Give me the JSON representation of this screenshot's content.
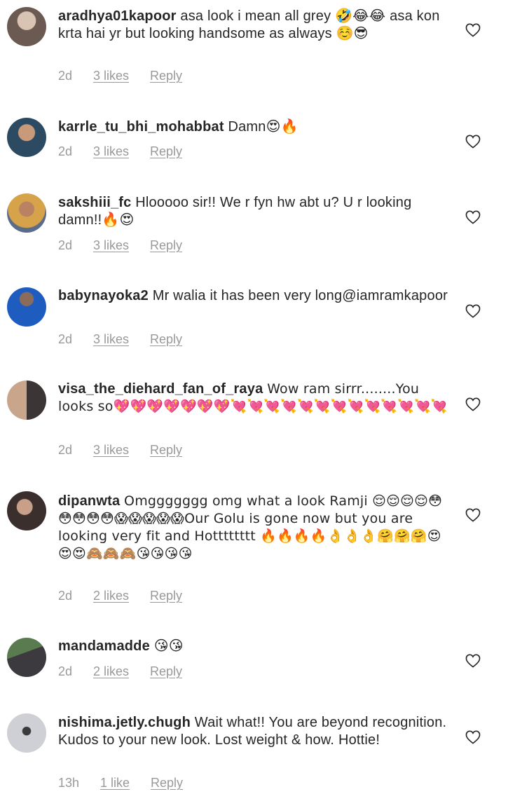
{
  "comments": [
    {
      "username": "aradhya01kapoor",
      "text": "asa look i mean all grey 🤣😂😂 asa kon krta hai yr but looking handsome as always ☺️😎",
      "time": "2d",
      "likes": "3 likes",
      "reply": "Reply"
    },
    {
      "username": "karrle_tu_bhi_mohabbat",
      "text": "Damn😍🔥",
      "time": "2d",
      "likes": "3 likes",
      "reply": "Reply"
    },
    {
      "username": "sakshiii_fc",
      "text": "Hlooooo sir!! We r fyn hw abt u? U r looking damn!!🔥😍",
      "time": "2d",
      "likes": "3 likes",
      "reply": "Reply"
    },
    {
      "username": "babynayoka2",
      "text": "Mr walia it has been very long@iamramkapoor",
      "time": "2d",
      "likes": "3 likes",
      "reply": "Reply"
    },
    {
      "username": "visa_the_diehard_fan_of_raya",
      "text": "Wow ram sirrr........You looks so💖💖💖💖💖💖💖💘💘💘💘💘💘💘💘💘💘💘💘💘",
      "time": "2d",
      "likes": "3 likes",
      "reply": "Reply"
    },
    {
      "username": "dipanwta",
      "text": "Omggggggg omg what a look Ramji 😌😌😌😌😳😳😳😳😳😱😱😱😱😱Our Golu is gone now but you are looking very fit and Hotttttttt 🔥🔥🔥🔥👌👌👌🤗🤗🤗😍😍😍🙈🙈🙈😘😘😘😘",
      "time": "2d",
      "likes": "2 likes",
      "reply": "Reply"
    },
    {
      "username": "mandamadde",
      "text": "😘😘",
      "time": "2d",
      "likes": "2 likes",
      "reply": "Reply"
    },
    {
      "username": "nishima.jetly.chugh",
      "text": "Wait what!! You are beyond recognition. Kudos to your new look. Lost weight & how. Hottie!",
      "time": "13h",
      "likes": "1 like",
      "reply": "Reply"
    }
  ]
}
